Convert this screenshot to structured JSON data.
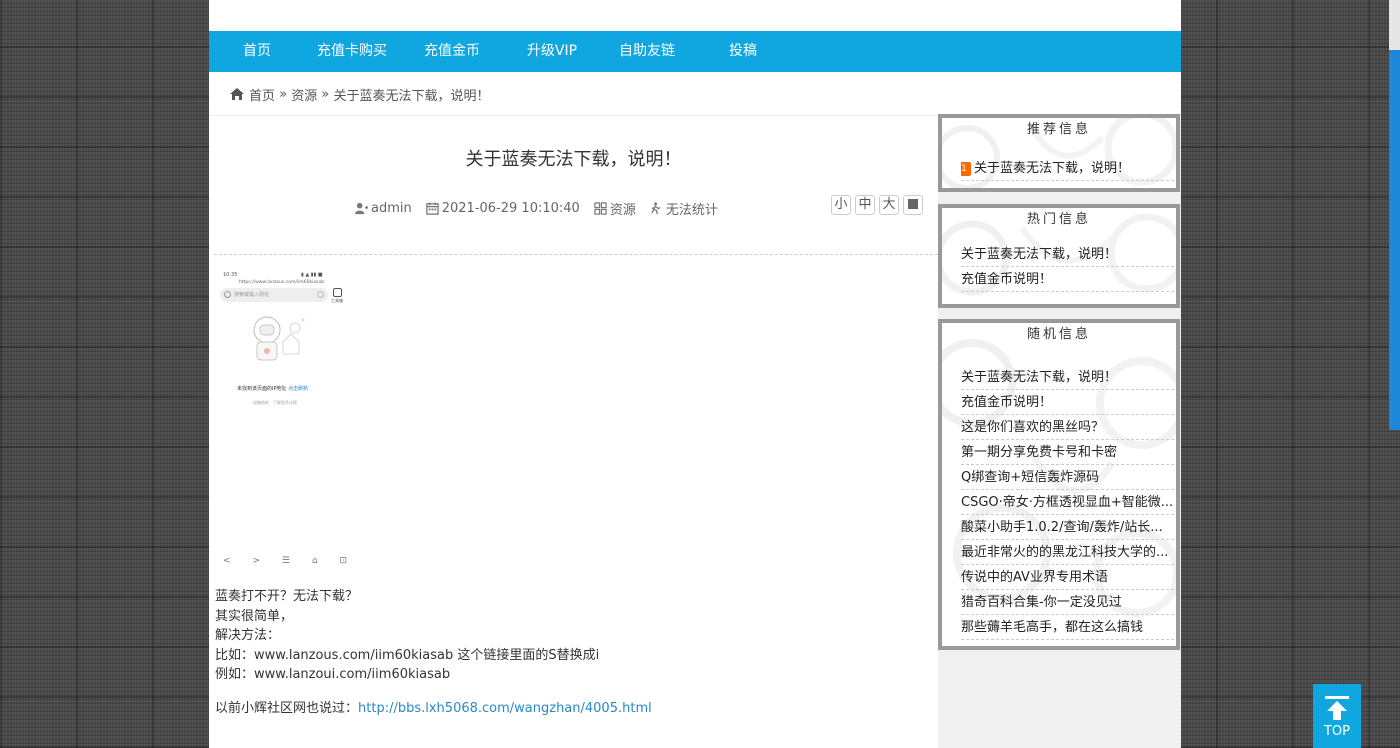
{
  "nav": {
    "items": [
      {
        "label": "首页"
      },
      {
        "label": "充值卡购买"
      },
      {
        "label": "充值金币"
      },
      {
        "label": "升级VIP"
      },
      {
        "label": "自助友链"
      },
      {
        "label": "投稿"
      }
    ]
  },
  "breadcrumb": {
    "home": "首页",
    "sep": "»",
    "category": "资源",
    "current": "关于蓝奏无法下载，说明！"
  },
  "article": {
    "title": "关于蓝奏无法下载，说明！",
    "author": "admin",
    "datetime": "2021-06-29 10:10:40",
    "category": "资源",
    "views": "无法统计",
    "font_sizes": [
      "小",
      "中",
      "大"
    ],
    "lines": [
      "蓝奏打不开？无法下载？",
      "其实很简单，",
      "解决方法：",
      "比如：www.lanzous.com/iim60kiasab 这个链接里面的S替换成i",
      "例如：www.lanzoui.com/iim60kiasab"
    ],
    "footer_prefix": "以前小辉社区网也说过：",
    "footer_link": "http://bbs.lxh5068.com/wangzhan/4005.html",
    "screenshot": {
      "time": "10:35",
      "url": "https://www.lanzous.com/iim60kiasab",
      "search_placeholder": "搜索或输入网址",
      "tab_label": "工具箱",
      "error": "未找到该页面的IP地址",
      "error_link": "点击刷新",
      "sub": "轻触刷新 · 了解更多详情"
    }
  },
  "sidebar": {
    "recommended": {
      "title": "推荐信息",
      "badge": "1",
      "items": [
        "关于蓝奏无法下载，说明！"
      ]
    },
    "hot": {
      "title": "热门信息",
      "items": [
        "关于蓝奏无法下载，说明！",
        "充值金币说明！"
      ]
    },
    "random": {
      "title": "随机信息",
      "items": [
        "关于蓝奏无法下载，说明！",
        "充值金币说明！",
        "这是你们喜欢的黑丝吗？",
        "第一期分享免费卡号和卡密",
        "Q绑查询+短信轰炸源码",
        "CSGO·帝女·方框透视显血+智能微...",
        "酸菜小助手1.0.2/查询/轰炸/站长...",
        "最近非常火的的黑龙江科技大学的...",
        "传说中的AV业界专用术语",
        "猎奇百科合集-你一定没见过",
        "那些薅羊毛高手，都在这么搞钱"
      ]
    }
  },
  "top_button": {
    "label": "TOP"
  },
  "colors": {
    "nav": "#10a7e0",
    "link": "#2a88c9",
    "badge": "#ff6a00",
    "box_border": "#999999"
  }
}
